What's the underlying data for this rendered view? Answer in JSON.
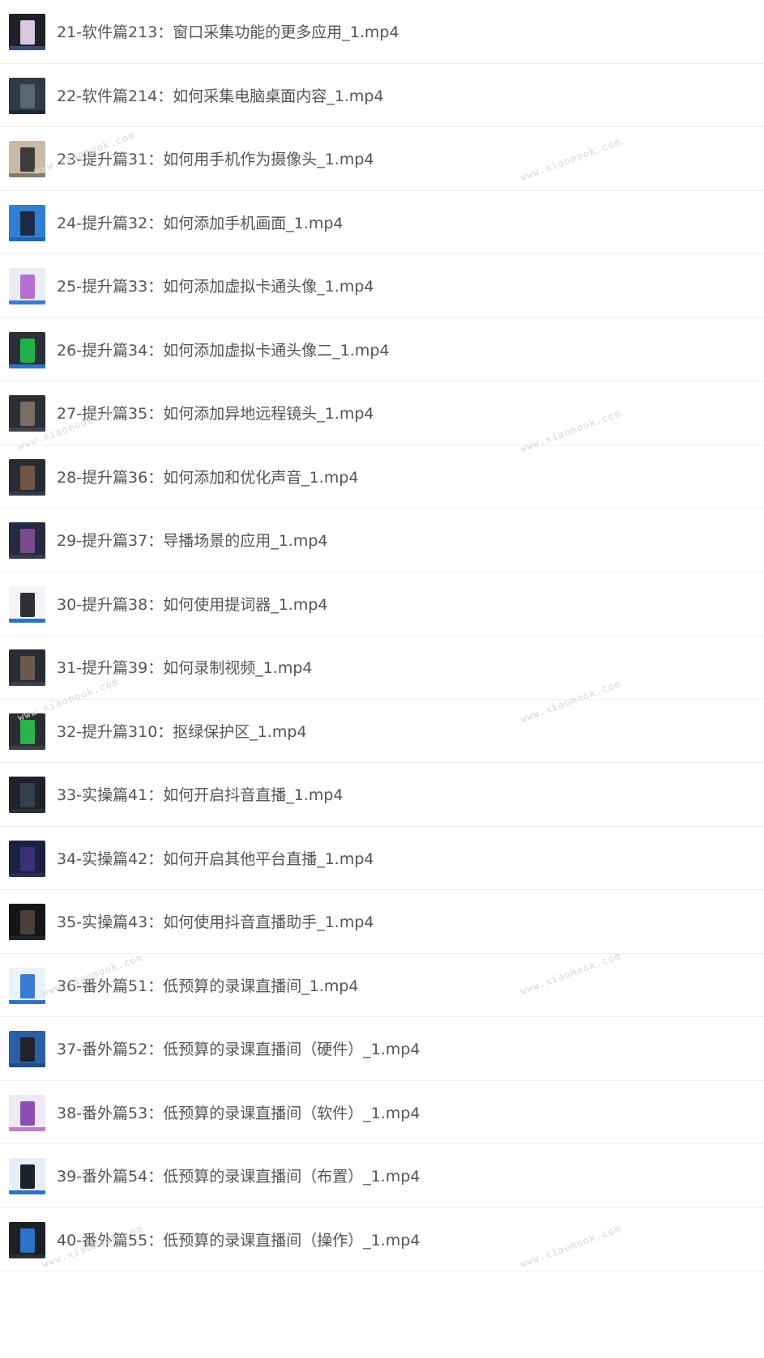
{
  "watermark_text": "www.xiaomook.com",
  "files": [
    {
      "name": "21-软件篇213：窗口采集功能的更多应用_1.mp4",
      "thumb": {
        "bg": "#1e2228",
        "inner": "#d7c7e0",
        "bar": "#3b4a78"
      }
    },
    {
      "name": "22-软件篇214：如何采集电脑桌面内容_1.mp4",
      "thumb": {
        "bg": "#2f3a46",
        "inner": "#5b6673",
        "bar": "#1f2a35"
      }
    },
    {
      "name": "23-提升篇31：如何用手机作为摄像头_1.mp4",
      "thumb": {
        "bg": "#c9b9a8",
        "inner": "#3c3c3c",
        "bar": "#8a7a6a"
      }
    },
    {
      "name": "24-提升篇32：如何添加手机画面_1.mp4",
      "thumb": {
        "bg": "#2f7fd6",
        "inner": "#1c2b44",
        "bar": "#2466b0"
      }
    },
    {
      "name": "25-提升篇33：如何添加虚拟卡通头像_1.mp4",
      "thumb": {
        "bg": "#e9eef4",
        "inner": "#b36fd1",
        "bar": "#3d7bd0"
      }
    },
    {
      "name": "26-提升篇34：如何添加虚拟卡通头像二_1.mp4",
      "thumb": {
        "bg": "#2b2f38",
        "inner": "#22b24c",
        "bar": "#2f73c8"
      }
    },
    {
      "name": "27-提升篇35：如何添加异地远程镜头_1.mp4",
      "thumb": {
        "bg": "#2c2f35",
        "inner": "#7b6e64",
        "bar": "#3e434c"
      }
    },
    {
      "name": "28-提升篇36：如何添加和优化声音_1.mp4",
      "thumb": {
        "bg": "#262a31",
        "inner": "#6d5646",
        "bar": "#353a43"
      }
    },
    {
      "name": "29-提升篇37：导播场景的应用_1.mp4",
      "thumb": {
        "bg": "#262a40",
        "inner": "#7a4b8c",
        "bar": "#353a52"
      }
    },
    {
      "name": "30-提升篇38：如何使用提词器_1.mp4",
      "thumb": {
        "bg": "#f2f4f7",
        "inner": "#2c2f35",
        "bar": "#2f73c8"
      }
    },
    {
      "name": "31-提升篇39：如何录制视频_1.mp4",
      "thumb": {
        "bg": "#282c33",
        "inner": "#6b5a50",
        "bar": "#3a3f48"
      }
    },
    {
      "name": "32-提升篇310：抠绿保护区_1.mp4",
      "thumb": {
        "bg": "#2a2e34",
        "inner": "#29b34a",
        "bar": "#3a3f48"
      }
    },
    {
      "name": "33-实操篇41：如何开启抖音直播_1.mp4",
      "thumb": {
        "bg": "#1f2329",
        "inner": "#34404c",
        "bar": "#2b3038"
      }
    },
    {
      "name": "34-实操篇42：如何开启其他平台直播_1.mp4",
      "thumb": {
        "bg": "#1c2040",
        "inner": "#3b2f7a",
        "bar": "#2a2f55"
      }
    },
    {
      "name": "35-实操篇43：如何使用抖音直播助手_1.mp4",
      "thumb": {
        "bg": "#14161a",
        "inner": "#4a3e38",
        "bar": "#22262c"
      }
    },
    {
      "name": "36-番外篇51：低预算的录课直播间_1.mp4",
      "thumb": {
        "bg": "#eaf2fb",
        "inner": "#3a7bd4",
        "bar": "#2f73c8"
      }
    },
    {
      "name": "37-番外篇52：低预算的录课直播间（硬件）_1.mp4",
      "thumb": {
        "bg": "#2a5fa8",
        "inner": "#202428",
        "bar": "#1c4c8a"
      }
    },
    {
      "name": "38-番外篇53：低预算的录课直播间（软件）_1.mp4",
      "thumb": {
        "bg": "#f0e8f2",
        "inner": "#8a4fb0",
        "bar": "#c07ad0"
      }
    },
    {
      "name": "39-番外篇54：低预算的录课直播间（布置）_1.mp4",
      "thumb": {
        "bg": "#e6eef6",
        "inner": "#1d2228",
        "bar": "#2f73c8"
      }
    },
    {
      "name": "40-番外篇55：低预算的录课直播间（操作）_1.mp4",
      "thumb": {
        "bg": "#1c2026",
        "inner": "#2f73c8",
        "bar": "#2a2f36"
      }
    }
  ]
}
